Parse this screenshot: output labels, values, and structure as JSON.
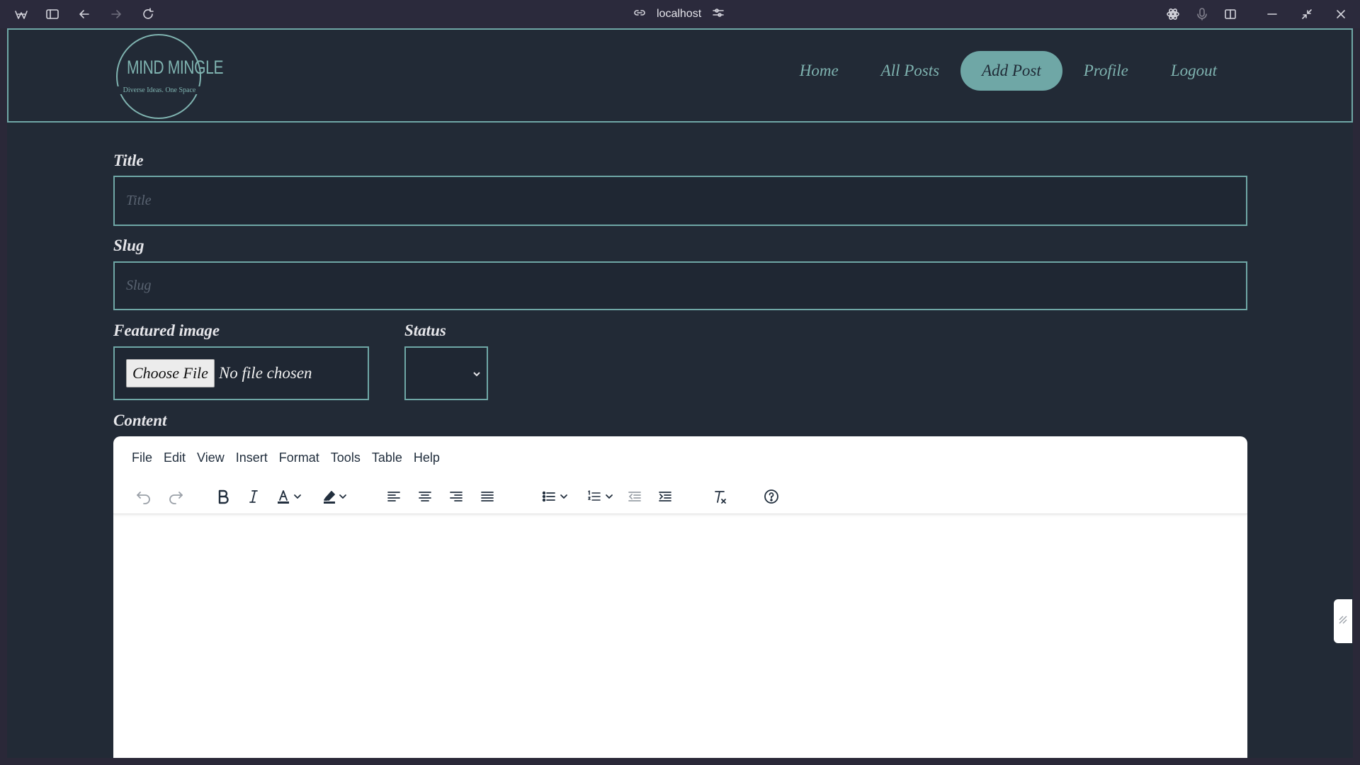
{
  "browser": {
    "url": "localhost"
  },
  "site": {
    "logo_title": "MIND MINGLE",
    "logo_tagline": "Diverse Ideas. One Space",
    "nav": [
      {
        "label": "Home"
      },
      {
        "label": "All Posts"
      },
      {
        "label": "Add Post",
        "active": true
      },
      {
        "label": "Profile"
      },
      {
        "label": "Logout"
      }
    ]
  },
  "form": {
    "title_label": "Title",
    "title_placeholder": "Title",
    "slug_label": "Slug",
    "slug_placeholder": "Slug",
    "image_label": "Featured image",
    "file_button": "Choose File",
    "file_status": "No file chosen",
    "status_label": "Status",
    "status_value": "",
    "content_label": "Content"
  },
  "editor": {
    "menu": [
      "File",
      "Edit",
      "View",
      "Insert",
      "Format",
      "Tools",
      "Table",
      "Help"
    ],
    "toolbar": [
      "undo-icon",
      "redo-icon",
      "bold-icon",
      "italic-icon",
      "text-color-icon",
      "highlight-color-icon",
      "align-left-icon",
      "align-center-icon",
      "align-right-icon",
      "align-justify-icon",
      "bullet-list-icon",
      "numbered-list-icon",
      "outdent-icon",
      "indent-icon",
      "clear-format-icon",
      "help-icon"
    ]
  },
  "colors": {
    "accent": "#6fa7a6",
    "page_bg": "#222a36",
    "chrome_bg": "#2b2a3c"
  }
}
